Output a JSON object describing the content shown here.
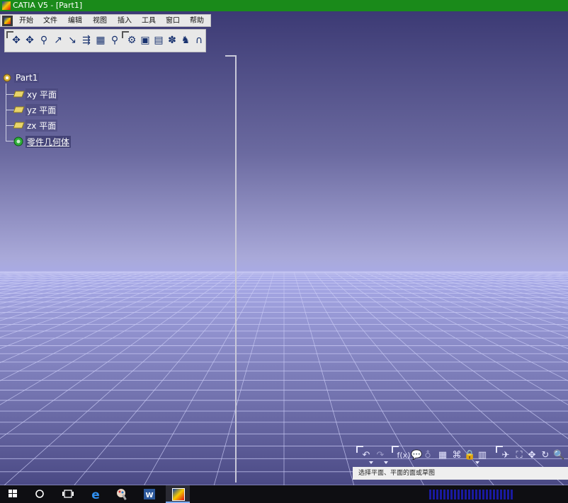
{
  "window": {
    "title": "CATIA V5 - [Part1]"
  },
  "menubar": {
    "items": [
      "开始",
      "文件",
      "编辑",
      "视图",
      "插入",
      "工具",
      "窗口",
      "帮助"
    ]
  },
  "tree": {
    "root": "Part1",
    "children": [
      "xy 平面",
      "yz 平面",
      "zx 平面",
      "零件几何体"
    ]
  },
  "statusbar": {
    "text": "选择平面、平面的面或草图"
  },
  "bottom_toolbar": {
    "formula_label": "f(x)"
  },
  "colors": {
    "title_bar": "#1a8a1a",
    "grid_line": "#c8c9f4",
    "taskbar": "#0e0e12",
    "tree_text": "#ffffff"
  },
  "toolbar_icons": [
    "translate-icon",
    "rotate-icon",
    "symmetry-icon",
    "axis-icon",
    "line-icon",
    "point-icon",
    "plane-icon",
    "extrude-icon",
    "pocket-icon",
    "measure-icon",
    "catalog-icon",
    "publish-icon",
    "knowledge-icon",
    "material-icon"
  ]
}
